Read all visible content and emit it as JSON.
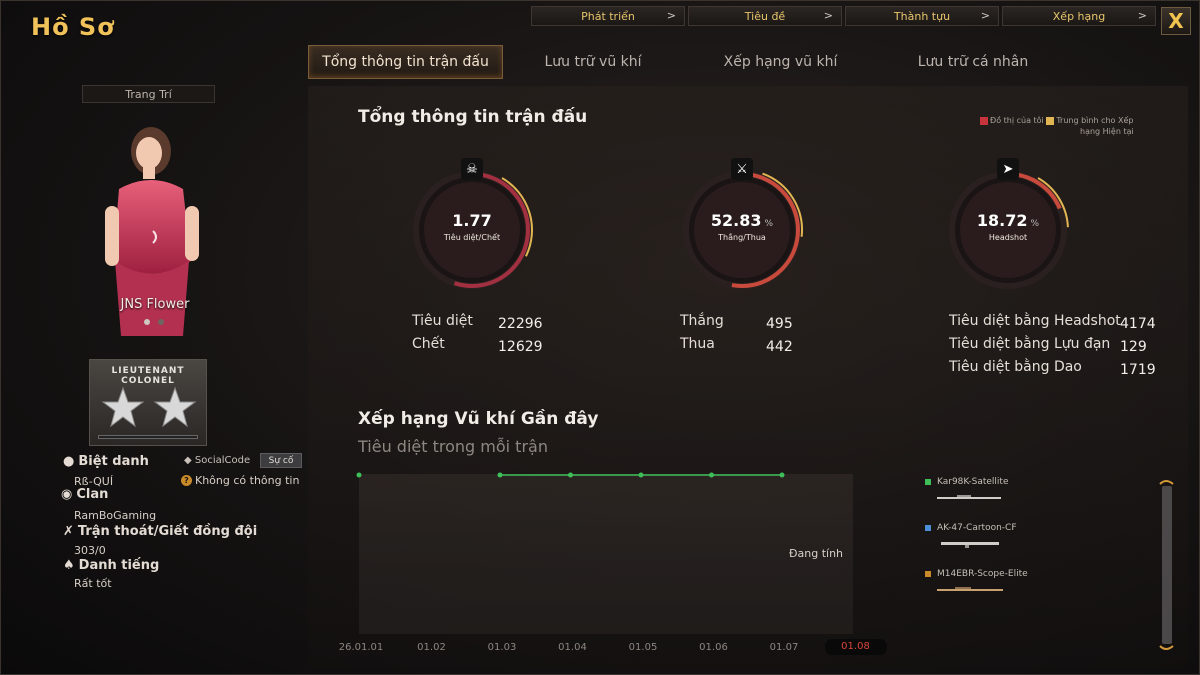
{
  "page_title": "Hồ Sơ",
  "top_nav": [
    {
      "label": "Phát triển"
    },
    {
      "label": "Tiêu đề"
    },
    {
      "label": "Thành tựu"
    },
    {
      "label": "Xếp hạng"
    }
  ],
  "close_label": "X",
  "sub_tabs": [
    {
      "label": "Tổng thông tin trận đấu",
      "active": true
    },
    {
      "label": "Lưu trữ vũ khí"
    },
    {
      "label": "Xếp hạng vũ khí"
    },
    {
      "label": "Lưu trữ cá nhân"
    }
  ],
  "profile": {
    "decor_label": "Trang Trí",
    "character_name": "JNS Flower",
    "rank_text_line1": "LIEUTENANT",
    "rank_text_line2": "COLONEL",
    "nickname_label": "Biệt danh",
    "nickname": "Rß-QUÍ",
    "socialcode_label": "SocialCode",
    "socialcode_button": "Sự cố",
    "socialcode_value": "Không có thông tin",
    "clan_label": "Clan",
    "clan": "RamBoGaming",
    "desert_label": "Trận thoát/Giết đồng đội",
    "desert_value": "303/0",
    "reputation_label": "Danh tiếng",
    "reputation": "Rất tốt"
  },
  "summary": {
    "title": "Tổng thông tin trận đấu",
    "legend_mine": "Đồ thị của tôi",
    "legend_avg_line1": "Trung bình cho Xếp",
    "legend_avg_line2": "hạng Hiện tại",
    "gauges": [
      {
        "value": "1.77",
        "unit": "",
        "label": "Tiêu diệt/Chết",
        "fill": 0.55,
        "icon": "skull-icon"
      },
      {
        "value": "52.83",
        "unit": "%",
        "label": "Thắng/Thua",
        "fill": 0.5283,
        "icon": "crossed-swords-icon"
      },
      {
        "value": "18.72",
        "unit": "%",
        "label": "Headshot",
        "fill": 0.1872,
        "icon": "rifle-icon"
      }
    ],
    "kills_label": "Tiêu diệt",
    "kills": "22296",
    "deaths_label": "Chết",
    "deaths": "12629",
    "wins_label": "Thắng",
    "wins": "495",
    "losses_label": "Thua",
    "losses": "442",
    "hs_kills_label": "Tiêu diệt bằng Headshot",
    "hs_kills": "4174",
    "grenade_kills_label": "Tiêu diệt bằng Lựu đạn",
    "grenade_kills": "129",
    "knife_kills_label": "Tiêu diệt bằng Dao",
    "knife_kills": "1719"
  },
  "recent": {
    "title": "Xếp hạng Vũ khí Gần đây",
    "subtitle": "Tiêu diệt trong mỗi trận",
    "calculating": "Đang tính",
    "x_ticks": [
      "26.01.01",
      "01.02",
      "01.03",
      "01.04",
      "01.05",
      "01.06",
      "01.07",
      "01.08"
    ],
    "selected_tick": "01.08",
    "weapons": [
      {
        "name": "Kar98K-Satellite",
        "color": "#3fbf5a"
      },
      {
        "name": "AK-47-Cartoon-CF",
        "color": "#4c8fd6"
      },
      {
        "name": "M14EBR-Scope-Elite",
        "color": "#c98a2a"
      }
    ]
  },
  "chart_data": {
    "type": "line",
    "title": "Tiêu diệt trong mỗi trận",
    "categories": [
      "26.01.01",
      "01.02",
      "01.03",
      "01.04",
      "01.05",
      "01.06",
      "01.07",
      "01.08"
    ],
    "series": [
      {
        "name": "Kar98K-Satellite",
        "values": [
          1,
          null,
          1,
          1,
          1,
          1,
          1,
          null
        ]
      }
    ]
  }
}
